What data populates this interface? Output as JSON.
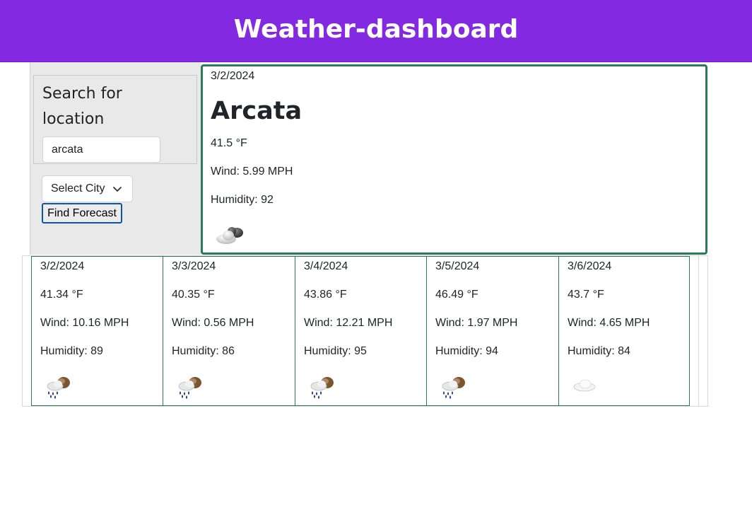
{
  "header": {
    "title": "Weather-dashboard"
  },
  "search": {
    "title": "Search for location",
    "input_value": "arcata",
    "select_label": "Select City",
    "button_label": "Find Forecast"
  },
  "current": {
    "date": "3/2/2024",
    "city": "Arcata",
    "temp": "41.5 °F",
    "wind": "Wind: 5.99 MPH",
    "humidity": "Humidity: 92",
    "icon": "partly-cloudy-night-icon"
  },
  "forecast": [
    {
      "date": "3/2/2024",
      "temp": "41.34 °F",
      "wind": "Wind: 10.16 MPH",
      "humidity": "Humidity: 89",
      "icon": "rain-icon"
    },
    {
      "date": "3/3/2024",
      "temp": "40.35 °F",
      "wind": "Wind: 0.56 MPH",
      "humidity": "Humidity: 86",
      "icon": "rain-icon"
    },
    {
      "date": "3/4/2024",
      "temp": "43.86 °F",
      "wind": "Wind: 12.21 MPH",
      "humidity": "Humidity: 95",
      "icon": "rain-icon"
    },
    {
      "date": "3/5/2024",
      "temp": "46.49 °F",
      "wind": "Wind: 1.97 MPH",
      "humidity": "Humidity: 94",
      "icon": "rain-icon"
    },
    {
      "date": "3/6/2024",
      "temp": "43.7 °F",
      "wind": "Wind: 4.65 MPH",
      "humidity": "Humidity: 84",
      "icon": "cloud-icon"
    }
  ],
  "colors": {
    "header_bg": "#8329e2",
    "card_border": "#2d7a56",
    "panel_bg": "#e9e9e9",
    "button_border": "#0b57a5"
  }
}
